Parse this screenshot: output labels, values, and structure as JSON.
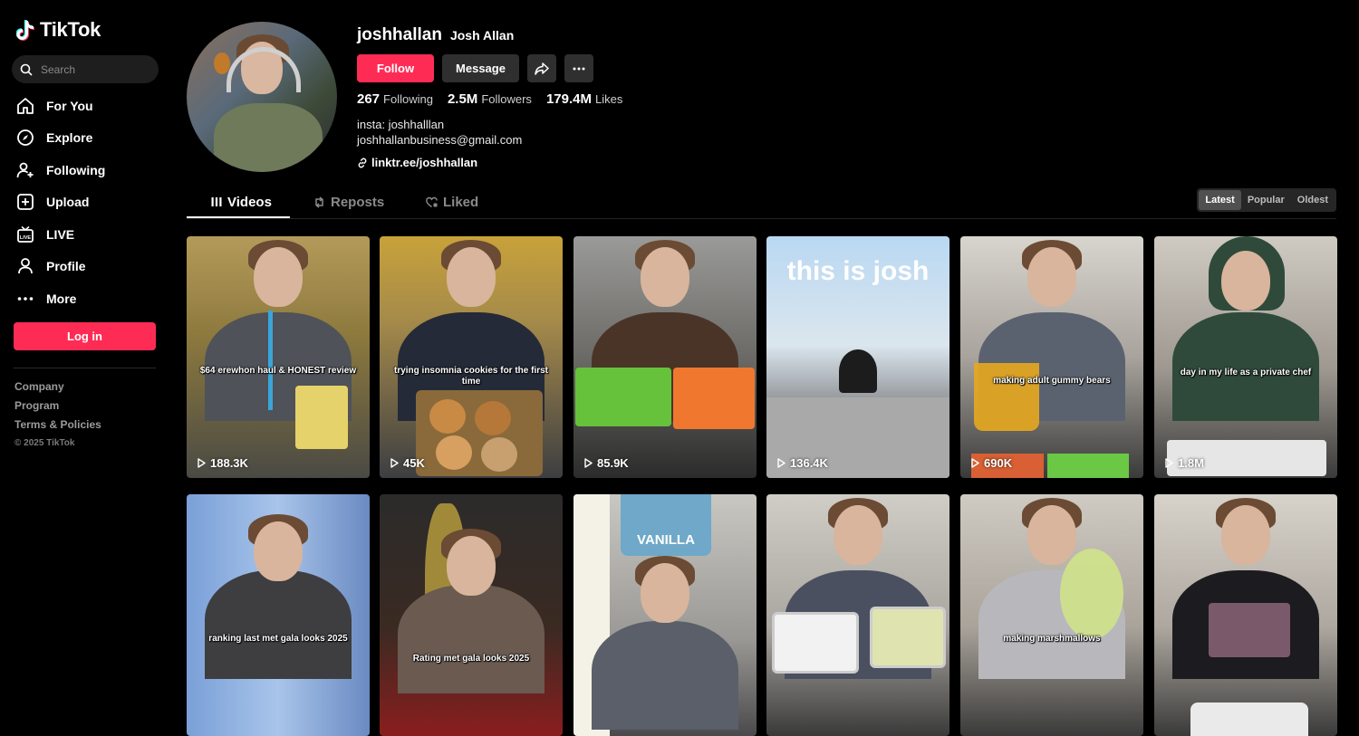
{
  "app": {
    "name": "TikTok"
  },
  "search": {
    "placeholder": "Search"
  },
  "nav": [
    {
      "label": "For You",
      "icon": "home-icon"
    },
    {
      "label": "Explore",
      "icon": "compass-icon"
    },
    {
      "label": "Following",
      "icon": "user-add-icon"
    },
    {
      "label": "Upload",
      "icon": "upload-icon"
    },
    {
      "label": "LIVE",
      "icon": "live-tv-icon"
    },
    {
      "label": "Profile",
      "icon": "person-icon"
    },
    {
      "label": "More",
      "icon": "more-dots-icon"
    }
  ],
  "login_label": "Log in",
  "footer": {
    "links": [
      "Company",
      "Program",
      "Terms & Policies"
    ],
    "copyright": "© 2025 TikTok"
  },
  "profile": {
    "handle": "joshhallan",
    "name": "Josh Allan",
    "follow_label": "Follow",
    "message_label": "Message",
    "stats": [
      {
        "value": "267",
        "label": "Following"
      },
      {
        "value": "2.5M",
        "label": "Followers"
      },
      {
        "value": "179.4M",
        "label": "Likes"
      }
    ],
    "bio_line1": "insta: joshhalllan",
    "bio_line2": "joshhallanbusiness@gmail.com",
    "link": "linktr.ee/joshhallan"
  },
  "tabs": [
    {
      "label": "Videos",
      "active": true
    },
    {
      "label": "Reposts",
      "active": false
    },
    {
      "label": "Liked",
      "active": false
    }
  ],
  "sort": {
    "options": [
      "Latest",
      "Popular",
      "Oldest"
    ],
    "selected": "Latest"
  },
  "videos": [
    {
      "caption": "$64 erewhon haul & HONEST review",
      "views": "188.3K"
    },
    {
      "caption": "trying insomnia cookies for the first time",
      "views": "45K"
    },
    {
      "caption": "",
      "views": "85.9K"
    },
    {
      "caption": "",
      "overlay": "this is josh",
      "views": "136.4K"
    },
    {
      "caption": "making adult gummy bears",
      "views": "690K"
    },
    {
      "caption": "day in my life as a private chef",
      "views": "1.8M"
    },
    {
      "caption": "ranking last met gala looks 2025",
      "views": ""
    },
    {
      "caption": "Rating met gala looks 2025",
      "views": ""
    },
    {
      "caption": "",
      "overlay": "VANILLA",
      "views": ""
    },
    {
      "caption": "",
      "views": ""
    },
    {
      "caption": "making marshmallows",
      "views": ""
    },
    {
      "caption": "",
      "views": ""
    }
  ],
  "colors": {
    "accent": "#fe2c55",
    "background": "#000000",
    "surface": "#2f2f2f"
  }
}
